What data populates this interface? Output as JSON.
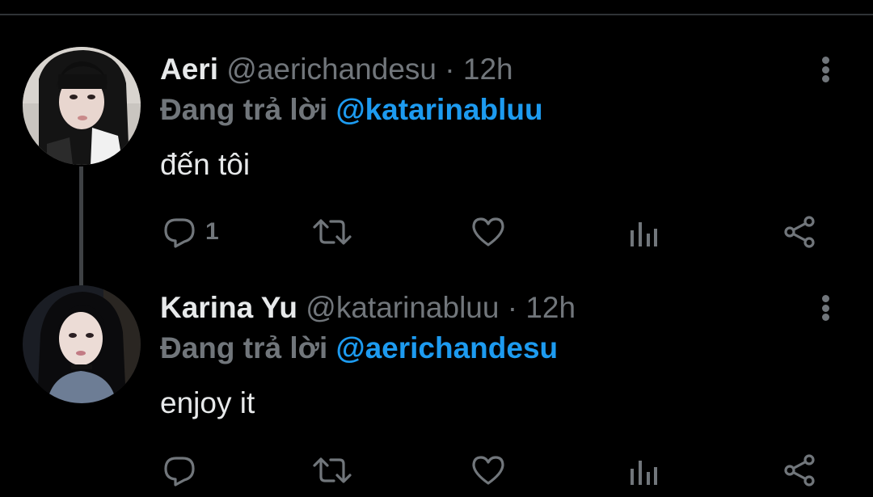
{
  "colors": {
    "background": "#000000",
    "primary_text": "#e7e9ea",
    "secondary_text": "#71767b",
    "mention_blue": "#1d9bf0",
    "divider": "#2f3336"
  },
  "tweets": [
    {
      "display_name": "Aeri",
      "handle_meta": "@aerichandesu · 12h",
      "reply_prefix": "Đang trả lời",
      "reply_to": "@katarinabluu",
      "text": "đến tôi",
      "reply_count": "1",
      "icons": [
        "reply-icon",
        "retweet-icon",
        "heart-icon",
        "views-icon",
        "share-icon",
        "more-icon"
      ]
    },
    {
      "display_name": "Karina Yu",
      "handle_meta": "@katarinabluu · 12h",
      "reply_prefix": "Đang trả lời",
      "reply_to": "@aerichandesu",
      "text": "enjoy it",
      "reply_count": "",
      "icons": [
        "reply-icon",
        "retweet-icon",
        "heart-icon",
        "views-icon",
        "share-icon",
        "more-icon"
      ]
    }
  ]
}
